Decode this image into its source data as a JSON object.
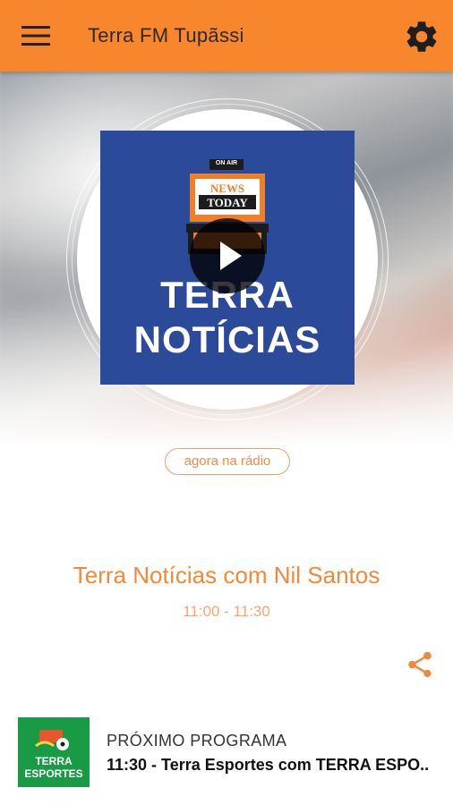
{
  "app_bar": {
    "title": "Terra FM Tupãssi",
    "menu_icon": "hamburger-menu-icon",
    "settings_icon": "gear-icon",
    "color": "#f8862c"
  },
  "now_playing": {
    "artwork": {
      "badge": "ON AIR",
      "sign_line1": "NEWS",
      "sign_line2": "TODAY",
      "title_line1": "TERRA",
      "title_line2": "NOTÍCIAS",
      "bg_color": "#2c4a9a"
    },
    "on_air_label": "agora na rádio",
    "program_title": "Terra Notícias com Nil Santos",
    "program_time": "11:00 - 11:30",
    "play_icon": "play-icon",
    "share_icon": "share-icon"
  },
  "next_program": {
    "label": "PRÓXIMO PROGRAMA",
    "text": "11:30 - Terra Esportes com TERRA ESPO..",
    "thumb_line1": "TERRA",
    "thumb_line2": "ESPORTES",
    "thumb_color": "#199a45"
  }
}
